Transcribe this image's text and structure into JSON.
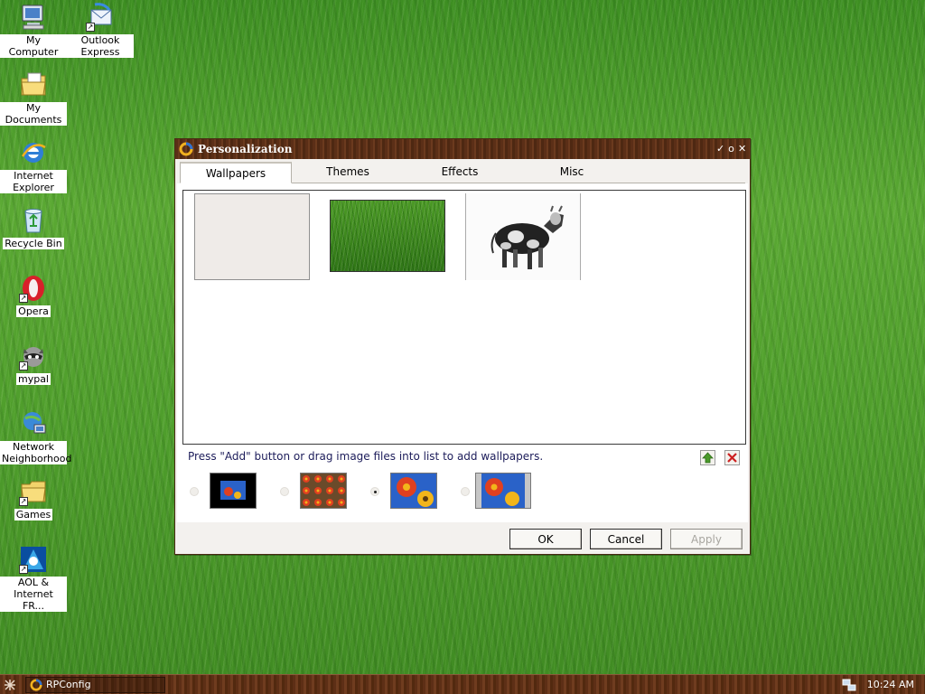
{
  "desktop": {
    "icons": [
      {
        "label": "My Computer"
      },
      {
        "label": "Outlook Express"
      },
      {
        "label": "My Documents"
      },
      {
        "label": "Internet Explorer"
      },
      {
        "label": "Recycle Bin"
      },
      {
        "label": "Opera"
      },
      {
        "label": "mypal"
      },
      {
        "label": "Network Neighborhood"
      },
      {
        "label": "Games"
      },
      {
        "label": "AOL & Internet FR..."
      }
    ]
  },
  "window": {
    "title": "Personalization",
    "tabs": [
      {
        "label": "Wallpapers",
        "active": true
      },
      {
        "label": "Themes"
      },
      {
        "label": "Effects"
      },
      {
        "label": "Misc"
      }
    ],
    "hint": "Press \"Add\" button or drag image files into list to add wallpapers.",
    "selected_mode_index": 2,
    "buttons": {
      "ok": "OK",
      "cancel": "Cancel",
      "apply": "Apply"
    }
  },
  "taskbar": {
    "task_label": "RPConfig",
    "clock": "10:24 AM"
  },
  "colors": {
    "titlebar": "#5b2f17",
    "taskbar": "#5d2f16",
    "hint_text": "#1c1c5a",
    "add_icon": "#4a9a2a",
    "remove_icon": "#cc2020"
  }
}
